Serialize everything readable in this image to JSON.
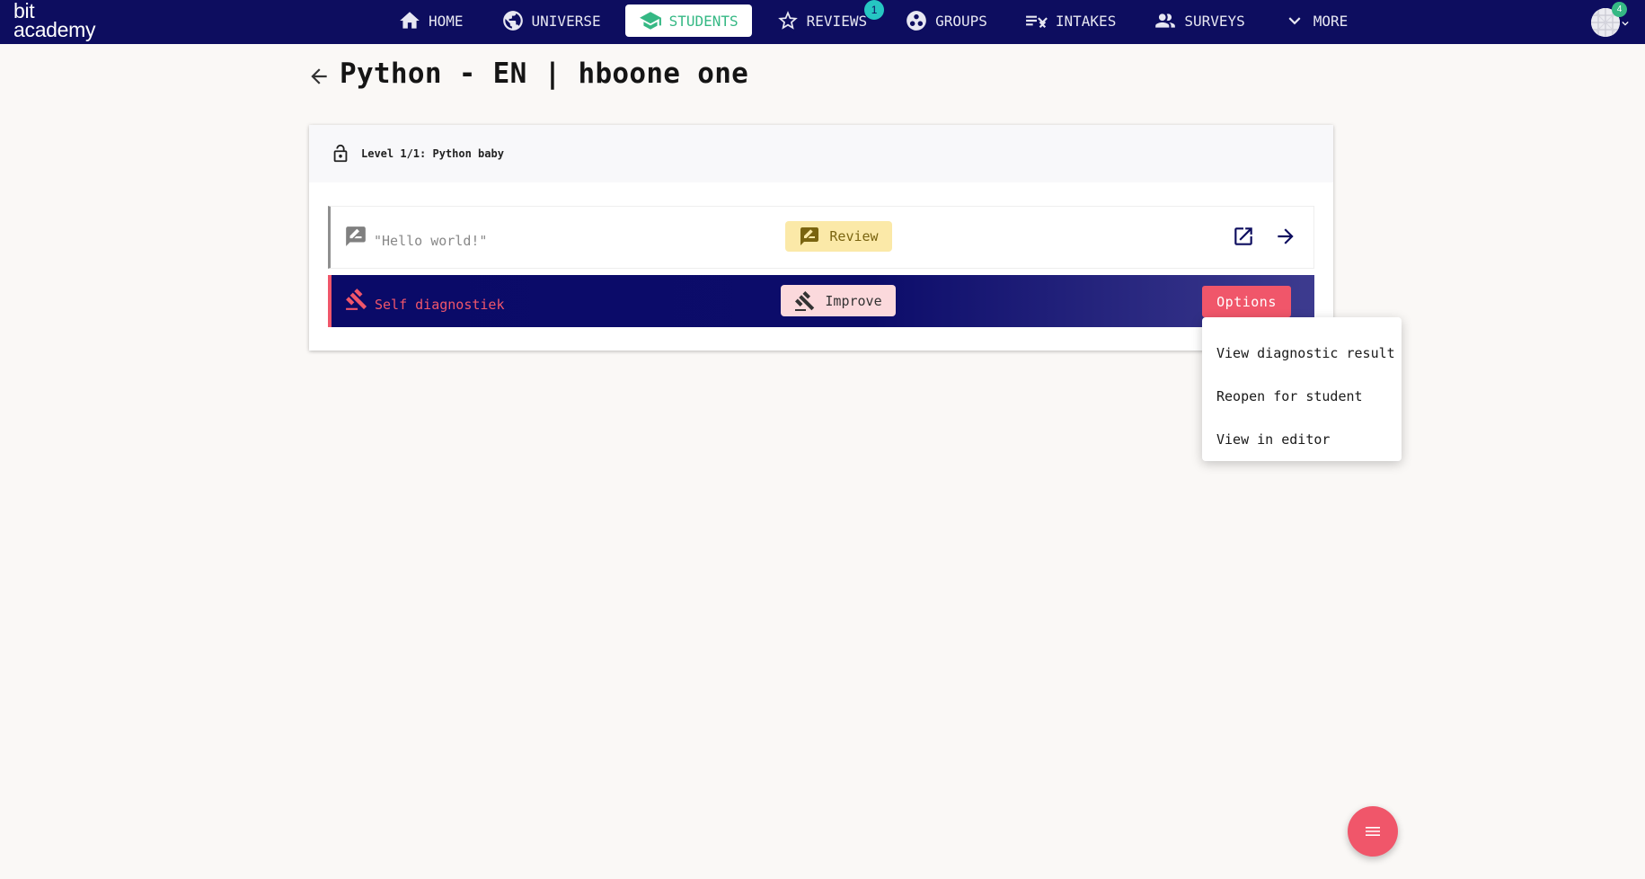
{
  "app": {
    "logo_line1": "bit",
    "logo_line2": "academy"
  },
  "nav": {
    "items": [
      {
        "label": "HOME",
        "icon": "home-icon"
      },
      {
        "label": "UNIVERSE",
        "icon": "globe-icon"
      },
      {
        "label": "STUDENTS",
        "icon": "graduation-cap-icon",
        "active": true
      },
      {
        "label": "REVIEWS",
        "icon": "star-icon",
        "badge": "1"
      },
      {
        "label": "GROUPS",
        "icon": "groups-icon"
      },
      {
        "label": "INTAKES",
        "icon": "checklist-icon"
      },
      {
        "label": "SURVEYS",
        "icon": "people-icon"
      },
      {
        "label": "MORE",
        "icon": "chevron-down-icon"
      }
    ],
    "avatar_badge": "4"
  },
  "header": {
    "title": "Python - EN | hboone one"
  },
  "level": {
    "title": "Level 1/1: Python baby",
    "icon": "lock-open-icon"
  },
  "assignments": [
    {
      "label": "\"Hello world!\"",
      "action_label": "Review",
      "icon": "feedback-icon",
      "action_icon": "rate-review-icon"
    },
    {
      "label": "Self diagnostiek",
      "action_label": "Improve",
      "icon": "gavel-icon",
      "action_icon": "gavel-icon",
      "options_label": "Options"
    }
  ],
  "options_menu": {
    "items": [
      "View diagnostic result",
      "Reopen for student",
      "View in editor"
    ]
  },
  "colors": {
    "nav_bg": "#0d0d5f",
    "accent_green": "#35b884",
    "accent_red": "#f0566a",
    "review_bg": "#fbe9a8",
    "improve_bg": "#fbd9dc"
  },
  "fab": {
    "icon": "menu-icon"
  }
}
